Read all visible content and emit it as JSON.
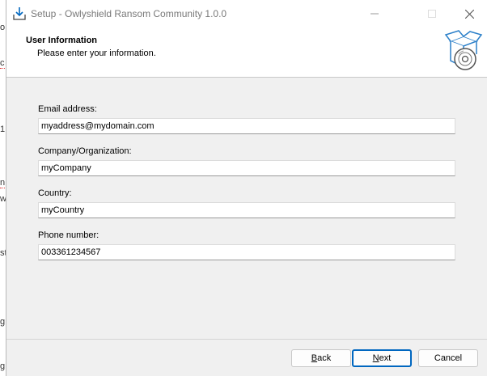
{
  "background_fragments": [
    "o",
    "c",
    "1",
    "n",
    "w",
    "st",
    "g",
    "g"
  ],
  "window": {
    "title": "Setup - Owlyshield Ransom Community 1.0.0",
    "controls": {
      "minimize": "minimize-icon",
      "maximize": "maximize-icon",
      "close": "close-icon"
    }
  },
  "header": {
    "title": "User Information",
    "subtitle": "Please enter your information.",
    "icon": "install-box-disc-icon"
  },
  "form": {
    "email": {
      "label": "Email address:",
      "value": "myaddress@mydomain.com"
    },
    "company": {
      "label": "Company/Organization:",
      "value": "myCompany"
    },
    "country": {
      "label": "Country:",
      "value": "myCountry"
    },
    "phone": {
      "label": "Phone number:",
      "value": "003361234567"
    }
  },
  "buttons": {
    "back": {
      "mnemonic": "B",
      "rest": "ack"
    },
    "next": {
      "mnemonic": "N",
      "rest": "ext"
    },
    "cancel": "Cancel"
  },
  "colors": {
    "accent": "#0067c0",
    "window_bg": "#f0f0f0",
    "header_bg": "#ffffff"
  }
}
